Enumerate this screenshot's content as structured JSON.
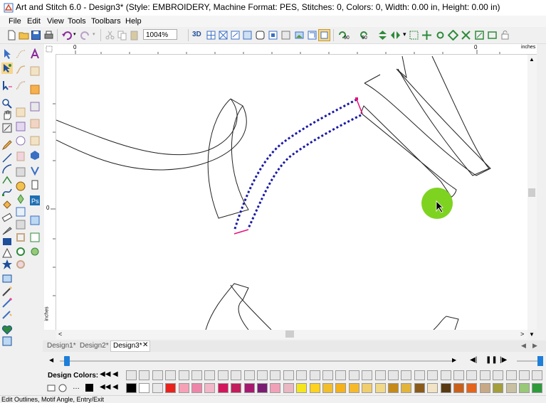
{
  "window": {
    "title": "Art and Stitch 6.0 - Design3* (Style: EMBROIDERY, Machine Format: PES, Stitches: 0, Colors: 0, Width: 0.00 in, Height: 0.00 in)"
  },
  "menu": {
    "items": [
      {
        "label": "File"
      },
      {
        "label": "Edit"
      },
      {
        "label": "View"
      },
      {
        "label": "Tools"
      },
      {
        "label": "Toolbars"
      },
      {
        "label": "Help"
      }
    ]
  },
  "toolbar": {
    "zoom": "1004%",
    "rotate_left_label": "90",
    "rotate_right_label": "90"
  },
  "rulers": {
    "units_top": "inches",
    "units_left": "inches",
    "zero_top": "0",
    "zero_top_left": "0",
    "zero_left": "0"
  },
  "tabs": [
    {
      "label": "Design1*",
      "active": false
    },
    {
      "label": "Design2*",
      "active": false
    },
    {
      "label": "Design3*",
      "active": true
    }
  ],
  "design_colors_label": "Design Colors:",
  "palette": {
    "selected_color": "#000000",
    "colors": [
      "#000000",
      "#ffffff",
      "#e8e8e8",
      "#e8231c",
      "#f7a1b7",
      "#ef86a9",
      "#f2b7c8",
      "#d3165b",
      "#c21d5c",
      "#a7196f",
      "#7a1d72",
      "#f2a0b8",
      "#e9b8c2",
      "#f5e61c",
      "#ffd21e",
      "#f2be2c",
      "#f5b21a",
      "#f6b92a",
      "#f0ce6e",
      "#f2d988",
      "#c58a18",
      "#e2b43a",
      "#8a5a1a",
      "#f2e3c4",
      "#5a3a12",
      "#c9601a",
      "#e4641c",
      "#c8a986",
      "#a49e3c",
      "#c8c0a0",
      "#98c878",
      "#2e9a3a"
    ]
  },
  "status": {
    "text": "Edit Outlines, Motif Angle, Entry/Exit"
  },
  "accent": {
    "selection": "#1a1aa8",
    "node_end": "#e8107a",
    "cursor_highlight": "#7ed321"
  }
}
